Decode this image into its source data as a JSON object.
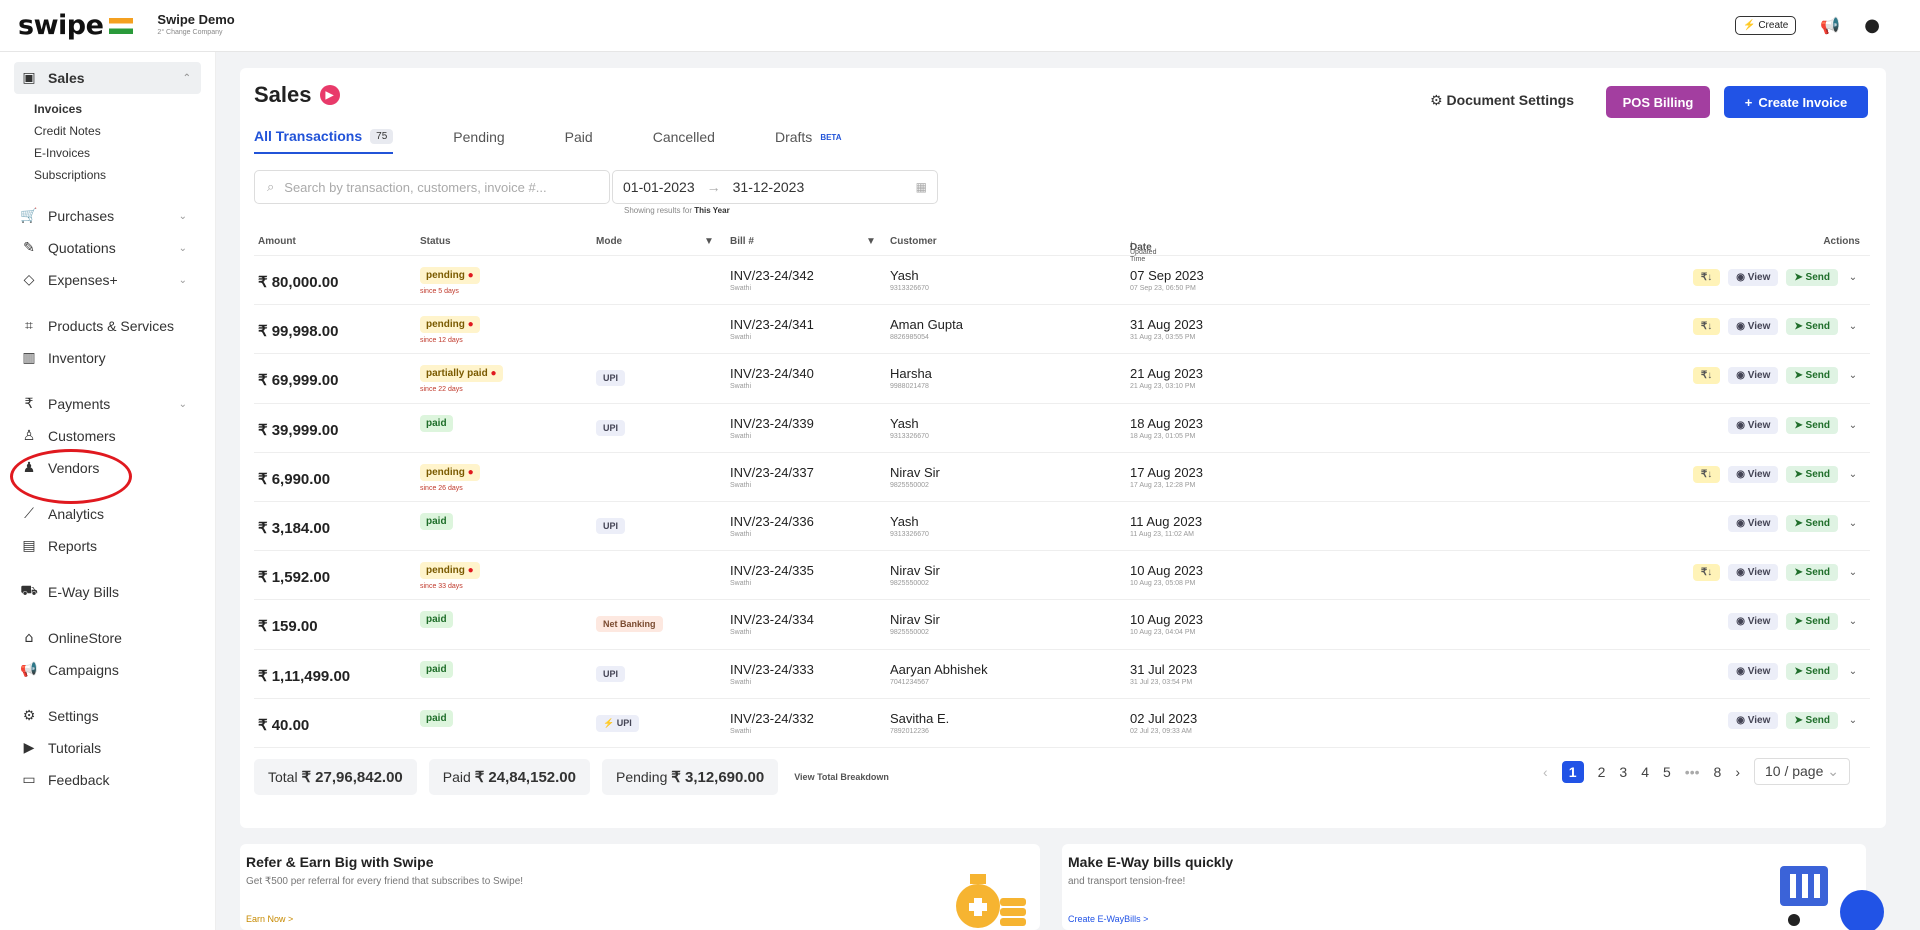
{
  "brand": {
    "logo": "swipe",
    "company_name": "Swipe Demo",
    "company_sub": "2° Change Company"
  },
  "topbar": {
    "create_label": "⚡ Create",
    "megaphone_icon": "megaphone-icon",
    "user_icon": "user-icon"
  },
  "sidebar": {
    "sales": "Sales",
    "sales_sub": [
      "Invoices",
      "Credit Notes",
      "E-Invoices",
      "Subscriptions"
    ],
    "purchases": "Purchases",
    "quotations": "Quotations",
    "expenses": "Expenses+",
    "products": "Products & Services",
    "inventory": "Inventory",
    "payments": "Payments",
    "customers": "Customers",
    "vendors": "Vendors",
    "analytics": "Analytics",
    "reports": "Reports",
    "eway": "E-Way Bills",
    "onlinestore": "OnlineStore",
    "campaigns": "Campaigns",
    "settings": "Settings",
    "tutorials": "Tutorials",
    "feedback": "Feedback"
  },
  "main": {
    "title": "Sales",
    "tabs": [
      {
        "label": "All Transactions",
        "count": "75"
      },
      {
        "label": "Pending"
      },
      {
        "label": "Paid"
      },
      {
        "label": "Cancelled"
      },
      {
        "label": "Drafts",
        "badge": "BETA"
      }
    ],
    "document_settings": "Document Settings",
    "pos_billing": "POS Billing",
    "create_invoice": "Create Invoice",
    "search_placeholder": "Search by transaction, customers, invoice #...",
    "date_from": "01-01-2023",
    "date_to": "31-12-2023",
    "hint_prefix": "Showing results for",
    "hint_bold": "This Year",
    "columns": {
      "amount": "Amount",
      "status": "Status",
      "mode": "Mode",
      "bill": "Bill #",
      "customer": "Customer",
      "date": "Date",
      "date_sub": "/ Updated Time",
      "actions": "Actions"
    },
    "rows": [
      {
        "amount": "₹ 80,000.00",
        "status": "pending",
        "since": "since 5 days",
        "mode": "",
        "bill": "INV/23-24/342",
        "bill_sub": "Swathi",
        "customer": "Yash",
        "cust_sub": "9313326670",
        "date": "07 Sep 2023",
        "date_sub": "07 Sep 23, 06:50 PM",
        "rs": true
      },
      {
        "amount": "₹ 99,998.00",
        "status": "pending",
        "since": "since 12 days",
        "mode": "",
        "bill": "INV/23-24/341",
        "bill_sub": "Swathi",
        "customer": "Aman Gupta",
        "cust_sub": "8826985054",
        "date": "31 Aug 2023",
        "date_sub": "31 Aug 23, 03:55 PM",
        "rs": true
      },
      {
        "amount": "₹ 69,999.00",
        "status": "partially paid",
        "since": "since 22 days",
        "mode": "UPI",
        "bill": "INV/23-24/340",
        "bill_sub": "Swathi",
        "customer": "Harsha",
        "cust_sub": "9988021478",
        "date": "21 Aug 2023",
        "date_sub": "21 Aug 23, 03:10 PM",
        "rs": true
      },
      {
        "amount": "₹ 39,999.00",
        "status": "paid",
        "since": "",
        "mode": "UPI",
        "bill": "INV/23-24/339",
        "bill_sub": "Swathi",
        "customer": "Yash",
        "cust_sub": "9313326670",
        "date": "18 Aug 2023",
        "date_sub": "18 Aug 23, 01:05 PM",
        "rs": false
      },
      {
        "amount": "₹ 6,990.00",
        "status": "pending",
        "since": "since 26 days",
        "mode": "",
        "bill": "INV/23-24/337",
        "bill_sub": "Swathi",
        "customer": "Nirav Sir",
        "cust_sub": "9825550002",
        "date": "17 Aug 2023",
        "date_sub": "17 Aug 23, 12:28 PM",
        "rs": true
      },
      {
        "amount": "₹ 3,184.00",
        "status": "paid",
        "since": "",
        "mode": "UPI",
        "bill": "INV/23-24/336",
        "bill_sub": "Swathi",
        "customer": "Yash",
        "cust_sub": "9313326670",
        "date": "11 Aug 2023",
        "date_sub": "11 Aug 23, 11:02 AM",
        "rs": false
      },
      {
        "amount": "₹ 1,592.00",
        "status": "pending",
        "since": "since 33 days",
        "mode": "",
        "bill": "INV/23-24/335",
        "bill_sub": "Swathi",
        "customer": "Nirav Sir",
        "cust_sub": "9825550002",
        "date": "10 Aug 2023",
        "date_sub": "10 Aug 23, 05:08 PM",
        "rs": true
      },
      {
        "amount": "₹ 159.00",
        "status": "paid",
        "since": "",
        "mode": "Net Banking",
        "bill": "INV/23-24/334",
        "bill_sub": "Swathi",
        "customer": "Nirav Sir",
        "cust_sub": "9825550002",
        "date": "10 Aug 2023",
        "date_sub": "10 Aug 23, 04:04 PM",
        "rs": false
      },
      {
        "amount": "₹ 1,11,499.00",
        "status": "paid",
        "since": "",
        "mode": "UPI",
        "bill": "INV/23-24/333",
        "bill_sub": "Swathi",
        "customer": "Aaryan Abhishek",
        "cust_sub": "7041234567",
        "date": "31 Jul 2023",
        "date_sub": "31 Jul 23, 03:54 PM",
        "rs": false
      },
      {
        "amount": "₹ 40.00",
        "status": "paid",
        "since": "",
        "mode": "⚡ UPI",
        "bill": "INV/23-24/332",
        "bill_sub": "Swathi",
        "customer": "Savitha E.",
        "cust_sub": "7892012236",
        "date": "02 Jul 2023",
        "date_sub": "02 Jul 23, 09:33 AM",
        "rs": false
      }
    ],
    "action_labels": {
      "rs": "₹↓",
      "view": "View",
      "send": "Send"
    },
    "totals": {
      "total_label": "Total",
      "total": "₹ 27,96,842.00",
      "paid_label": "Paid",
      "paid": "₹ 24,84,152.00",
      "pending_label": "Pending",
      "pending": "₹ 3,12,690.00",
      "breakdown": "View Total Breakdown"
    },
    "pagination": {
      "pages": [
        "1",
        "2",
        "3",
        "4",
        "5",
        "•••",
        "8"
      ],
      "per_page": "10 / page"
    }
  },
  "cards": {
    "refer_title": "Refer & Earn Big with Swipe",
    "refer_desc": "Get ₹500 per referral for every friend that subscribes to Swipe!",
    "refer_link": "Earn Now >",
    "eway_title": "Make E-Way bills quickly",
    "eway_desc": "and transport tension-free!",
    "eway_link": "Create E-WayBills >"
  },
  "colors": {
    "primary": "#2153e6",
    "pos": "#a33ea0",
    "highlight_circle": "#e0191f"
  }
}
